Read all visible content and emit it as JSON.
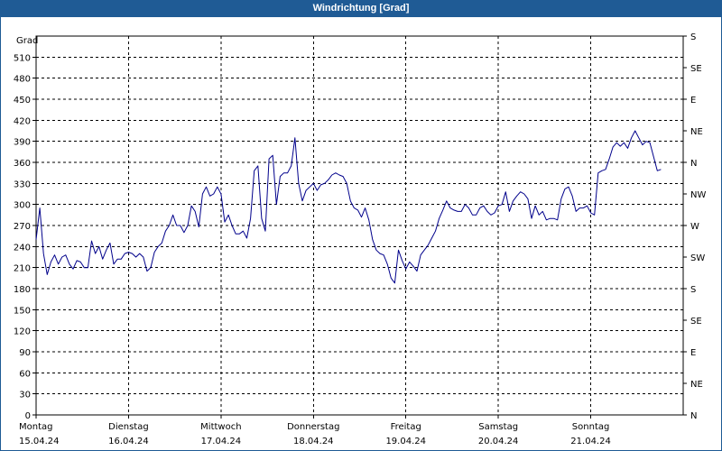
{
  "window": {
    "title": "Windrichtung [Grad]"
  },
  "chart_data": {
    "type": "line",
    "title": "Windrichtung [Grad]",
    "ylabel": "Grad",
    "ylim": [
      0,
      540
    ],
    "y_ticks": [
      0,
      30,
      60,
      90,
      120,
      150,
      180,
      210,
      240,
      270,
      300,
      330,
      360,
      390,
      420,
      450,
      480,
      510
    ],
    "y_right_ticks": [
      {
        "value": 0,
        "label": "N"
      },
      {
        "value": 45,
        "label": "NE"
      },
      {
        "value": 90,
        "label": "E"
      },
      {
        "value": 135,
        "label": "SE"
      },
      {
        "value": 180,
        "label": "S"
      },
      {
        "value": 225,
        "label": "SW"
      },
      {
        "value": 270,
        "label": "W"
      },
      {
        "value": 315,
        "label": "NW"
      },
      {
        "value": 360,
        "label": "N"
      },
      {
        "value": 405,
        "label": "NE"
      },
      {
        "value": 450,
        "label": "E"
      },
      {
        "value": 495,
        "label": "SE"
      },
      {
        "value": 540,
        "label": "S"
      }
    ],
    "xlim": [
      0,
      7
    ],
    "x_days": [
      {
        "day": "Montag",
        "date": "15.04.24"
      },
      {
        "day": "Dienstag",
        "date": "16.04.24"
      },
      {
        "day": "Mittwoch",
        "date": "17.04.24"
      },
      {
        "day": "Donnerstag",
        "date": "18.04.24"
      },
      {
        "day": "Freitag",
        "date": "19.04.24"
      },
      {
        "day": "Samstag",
        "date": "20.04.24"
      },
      {
        "day": "Sonntag",
        "date": "21.04.24"
      }
    ],
    "grid": true,
    "line_color": "#00008b",
    "series": [
      {
        "values": [
          [
            0.0,
            250
          ],
          [
            0.04,
            295
          ],
          [
            0.08,
            230
          ],
          [
            0.12,
            200
          ],
          [
            0.16,
            218
          ],
          [
            0.2,
            228
          ],
          [
            0.24,
            215
          ],
          [
            0.28,
            225
          ],
          [
            0.32,
            228
          ],
          [
            0.36,
            215
          ],
          [
            0.4,
            208
          ],
          [
            0.44,
            220
          ],
          [
            0.48,
            218
          ],
          [
            0.52,
            210
          ],
          [
            0.56,
            210
          ],
          [
            0.6,
            248
          ],
          [
            0.64,
            230
          ],
          [
            0.68,
            240
          ],
          [
            0.72,
            222
          ],
          [
            0.76,
            235
          ],
          [
            0.8,
            245
          ],
          [
            0.84,
            215
          ],
          [
            0.88,
            222
          ],
          [
            0.92,
            222
          ],
          [
            0.96,
            230
          ],
          [
            1.0,
            232
          ],
          [
            1.04,
            230
          ],
          [
            1.08,
            225
          ],
          [
            1.12,
            230
          ],
          [
            1.16,
            225
          ],
          [
            1.2,
            205
          ],
          [
            1.24,
            210
          ],
          [
            1.28,
            232
          ],
          [
            1.32,
            240
          ],
          [
            1.36,
            245
          ],
          [
            1.4,
            262
          ],
          [
            1.44,
            270
          ],
          [
            1.48,
            285
          ],
          [
            1.52,
            270
          ],
          [
            1.56,
            270
          ],
          [
            1.6,
            260
          ],
          [
            1.64,
            270
          ],
          [
            1.68,
            298
          ],
          [
            1.72,
            290
          ],
          [
            1.76,
            268
          ],
          [
            1.8,
            315
          ],
          [
            1.84,
            325
          ],
          [
            1.88,
            312
          ],
          [
            1.92,
            315
          ],
          [
            1.96,
            325
          ],
          [
            2.0,
            315
          ],
          [
            2.04,
            275
          ],
          [
            2.08,
            285
          ],
          [
            2.12,
            270
          ],
          [
            2.16,
            258
          ],
          [
            2.2,
            258
          ],
          [
            2.24,
            262
          ],
          [
            2.28,
            252
          ],
          [
            2.32,
            280
          ],
          [
            2.36,
            348
          ],
          [
            2.4,
            355
          ],
          [
            2.44,
            280
          ],
          [
            2.48,
            262
          ],
          [
            2.52,
            365
          ],
          [
            2.56,
            370
          ],
          [
            2.6,
            300
          ],
          [
            2.64,
            340
          ],
          [
            2.68,
            345
          ],
          [
            2.72,
            345
          ],
          [
            2.76,
            355
          ],
          [
            2.8,
            395
          ],
          [
            2.84,
            330
          ],
          [
            2.88,
            305
          ],
          [
            2.92,
            320
          ],
          [
            2.96,
            325
          ],
          [
            3.0,
            330
          ],
          [
            3.04,
            320
          ],
          [
            3.08,
            328
          ],
          [
            3.12,
            330
          ],
          [
            3.16,
            335
          ],
          [
            3.2,
            342
          ],
          [
            3.24,
            345
          ],
          [
            3.28,
            342
          ],
          [
            3.32,
            340
          ],
          [
            3.36,
            330
          ],
          [
            3.4,
            305
          ],
          [
            3.44,
            295
          ],
          [
            3.48,
            292
          ],
          [
            3.52,
            282
          ],
          [
            3.56,
            295
          ],
          [
            3.6,
            278
          ],
          [
            3.64,
            250
          ],
          [
            3.68,
            235
          ],
          [
            3.72,
            230
          ],
          [
            3.76,
            228
          ],
          [
            3.8,
            215
          ],
          [
            3.84,
            195
          ],
          [
            3.88,
            188
          ],
          [
            3.92,
            235
          ],
          [
            3.96,
            220
          ],
          [
            4.0,
            208
          ],
          [
            4.04,
            218
          ],
          [
            4.08,
            212
          ],
          [
            4.12,
            205
          ],
          [
            4.16,
            228
          ],
          [
            4.2,
            235
          ],
          [
            4.24,
            242
          ],
          [
            4.28,
            252
          ],
          [
            4.32,
            262
          ],
          [
            4.36,
            280
          ],
          [
            4.4,
            292
          ],
          [
            4.44,
            305
          ],
          [
            4.48,
            295
          ],
          [
            4.52,
            292
          ],
          [
            4.56,
            290
          ],
          [
            4.6,
            290
          ],
          [
            4.64,
            300
          ],
          [
            4.68,
            295
          ],
          [
            4.72,
            285
          ],
          [
            4.76,
            285
          ],
          [
            4.8,
            295
          ],
          [
            4.84,
            298
          ],
          [
            4.88,
            290
          ],
          [
            4.92,
            285
          ],
          [
            4.96,
            288
          ],
          [
            5.0,
            298
          ],
          [
            5.04,
            300
          ],
          [
            5.08,
            318
          ],
          [
            5.12,
            290
          ],
          [
            5.16,
            305
          ],
          [
            5.2,
            312
          ],
          [
            5.24,
            318
          ],
          [
            5.28,
            315
          ],
          [
            5.32,
            308
          ],
          [
            5.36,
            280
          ],
          [
            5.4,
            298
          ],
          [
            5.44,
            285
          ],
          [
            5.48,
            290
          ],
          [
            5.52,
            278
          ],
          [
            5.56,
            280
          ],
          [
            5.6,
            280
          ],
          [
            5.64,
            278
          ],
          [
            5.68,
            308
          ],
          [
            5.72,
            322
          ],
          [
            5.76,
            325
          ],
          [
            5.8,
            312
          ],
          [
            5.84,
            290
          ],
          [
            5.88,
            295
          ],
          [
            5.92,
            295
          ],
          [
            5.96,
            298
          ],
          [
            6.0,
            288
          ],
          [
            6.04,
            285
          ],
          [
            6.08,
            345
          ],
          [
            6.12,
            348
          ],
          [
            6.16,
            350
          ],
          [
            6.2,
            365
          ],
          [
            6.24,
            382
          ],
          [
            6.28,
            388
          ],
          [
            6.32,
            383
          ],
          [
            6.36,
            388
          ],
          [
            6.4,
            380
          ],
          [
            6.44,
            395
          ],
          [
            6.48,
            405
          ],
          [
            6.52,
            395
          ],
          [
            6.56,
            385
          ],
          [
            6.6,
            390
          ],
          [
            6.64,
            388
          ],
          [
            6.68,
            368
          ],
          [
            6.72,
            348
          ],
          [
            6.76,
            350
          ]
        ]
      }
    ]
  }
}
